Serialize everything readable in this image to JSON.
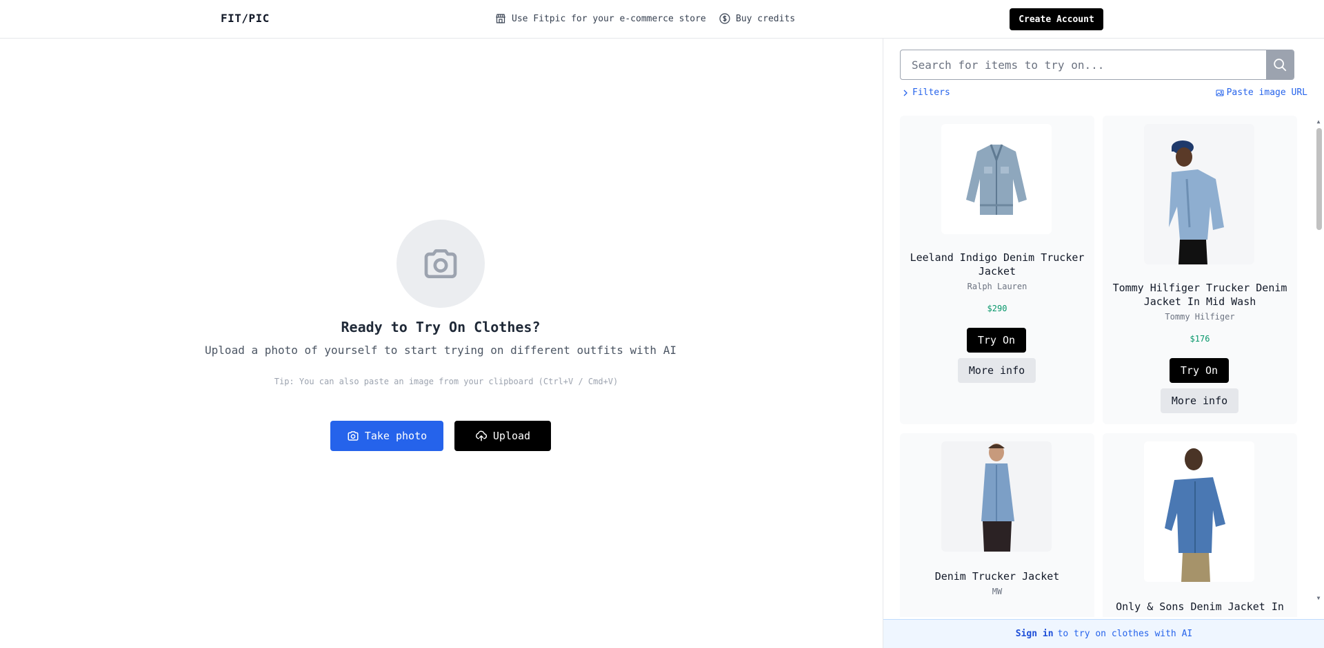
{
  "header": {
    "logo": "FIT/PIC",
    "store_link": "Use Fitpic for your e-commerce store",
    "credits_link": "Buy credits",
    "create_account": "Create Account"
  },
  "main": {
    "title": "Ready to Try On Clothes?",
    "subtitle": "Upload a photo of yourself to start trying on different outfits with AI",
    "tip": "Tip: You can also paste an image from your clipboard (Ctrl+V / Cmd+V)",
    "take_photo": "Take photo",
    "upload": "Upload"
  },
  "panel": {
    "search_placeholder": "Search for items to try on...",
    "filters": "Filters",
    "paste_url": "Paste image URL",
    "products": [
      {
        "title": "Leeland Indigo Denim Trucker Jacket",
        "brand": "Ralph Lauren",
        "price": "$290",
        "try_on": "Try On",
        "more_info": "More info"
      },
      {
        "title": "Tommy Hilfiger Trucker Denim Jacket In Mid Wash",
        "brand": "Tommy Hilfiger",
        "price": "$176",
        "try_on": "Try On",
        "more_info": "More info"
      },
      {
        "title": "Denim Trucker Jacket",
        "brand": "MW"
      },
      {
        "title": "Only & Sons Denim Jacket In"
      }
    ],
    "signin_link": "Sign in",
    "signin_text": "to try on clothes with AI"
  },
  "colors": {
    "accent_blue": "#2563eb",
    "price_green": "#059669",
    "button_black": "#000000"
  }
}
